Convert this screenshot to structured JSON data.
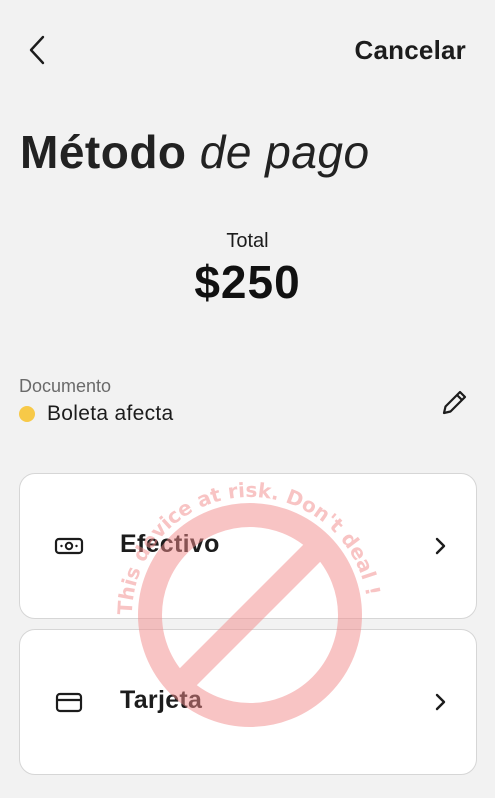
{
  "header": {
    "back_icon": "chevron-left-icon",
    "cancel_label": "Cancelar"
  },
  "title": {
    "bold": "Método",
    "italic": "de pago"
  },
  "total": {
    "label": "Total",
    "amount": "$250"
  },
  "document": {
    "label": "Documento",
    "value": "Boleta afecta",
    "status_color": "#f7c948",
    "edit_icon": "pencil-icon"
  },
  "payment_options": [
    {
      "label": "Efectivo",
      "icon": "cash-icon"
    },
    {
      "label": "Tarjeta",
      "icon": "credit-card-icon"
    }
  ],
  "watermark": {
    "text": "This device at risk. Don't deal !",
    "color": "#f28b8b"
  },
  "colors": {
    "background": "#f2f2f2",
    "card": "#ffffff",
    "card_border": "#d6d6d6",
    "text": "#1c1c1c"
  }
}
